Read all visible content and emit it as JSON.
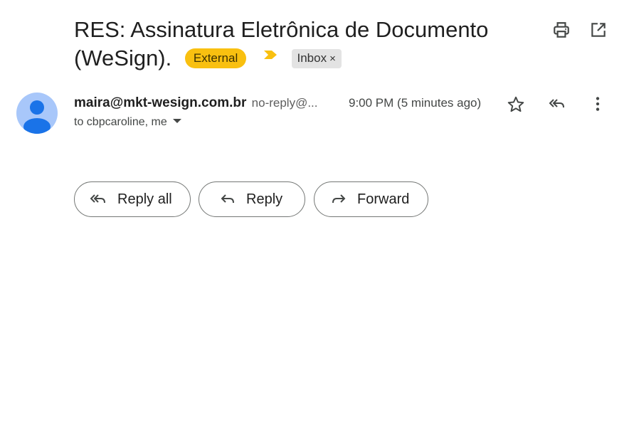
{
  "email": {
    "subject": "RES: Assinatura Eletrônica de Documento (WeSign).",
    "labels": {
      "external": "External",
      "inbox": "Inbox",
      "inbox_remove": "×"
    },
    "sender_name": "maira@mkt-wesign.com.br",
    "sender_email": "no-reply@...",
    "time": "9:00 PM (5 minutes ago)",
    "recipients": "to cbpcaroline, me"
  },
  "actions": {
    "reply_all": "Reply all",
    "reply": "Reply",
    "forward": "Forward"
  },
  "icons": {
    "print": "print-icon",
    "open_new_window": "open-in-new-window-icon",
    "star": "star-icon",
    "reply_all": "reply-all-icon",
    "more": "more-vert-icon",
    "important": "important-marker-icon"
  },
  "colors": {
    "external_chip": "#f9c010",
    "important_marker": "#f9c010",
    "avatar_bg": "#a8c7fa",
    "avatar_fg": "#1a73e8",
    "inbox_chip": "#e3e3e3"
  }
}
